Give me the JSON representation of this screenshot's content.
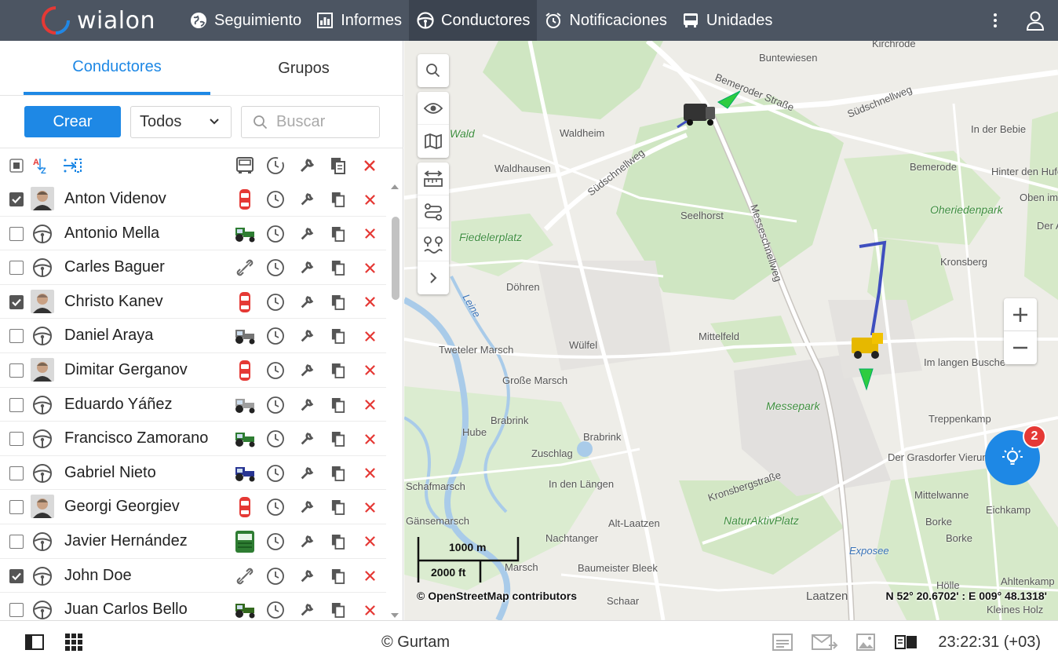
{
  "app": {
    "logo_text": "wialon"
  },
  "nav": [
    {
      "label": "Seguimiento",
      "icon": "globe-icon"
    },
    {
      "label": "Informes",
      "icon": "report-icon"
    },
    {
      "label": "Conductores",
      "icon": "steering-wheel-icon",
      "active": true
    },
    {
      "label": "Notificaciones",
      "icon": "alarm-clock-icon"
    },
    {
      "label": "Unidades",
      "icon": "bus-icon"
    }
  ],
  "panel": {
    "tabs": [
      "Conductores",
      "Grupos"
    ],
    "create_label": "Crear",
    "filter_value": "Todos",
    "search_placeholder": "Buscar"
  },
  "drivers": [
    {
      "name": "Anton Videnov",
      "checked": true,
      "avatar": "photo",
      "unit": "car",
      "unit_color": "#e53935"
    },
    {
      "name": "Antonio Mella",
      "checked": false,
      "avatar": "wheel",
      "unit": "tractor",
      "unit_color": "#2e7d32"
    },
    {
      "name": "Carles Baguer",
      "checked": false,
      "avatar": "wheel",
      "unit": "unlinked",
      "unit_color": "#666666"
    },
    {
      "name": "Christo Kanev",
      "checked": true,
      "avatar": "photo",
      "unit": "car",
      "unit_color": "#e53935"
    },
    {
      "name": "Daniel Araya",
      "checked": false,
      "avatar": "wheel",
      "unit": "tractor",
      "unit_color": "#757575"
    },
    {
      "name": "Dimitar Gerganov",
      "checked": false,
      "avatar": "photo",
      "unit": "car",
      "unit_color": "#e53935"
    },
    {
      "name": "Eduardo Yáñez",
      "checked": false,
      "avatar": "wheel",
      "unit": "tractor",
      "unit_color": "#9e9e9e"
    },
    {
      "name": "Francisco Zamorano",
      "checked": false,
      "avatar": "wheel",
      "unit": "tractor",
      "unit_color": "#2e7d32"
    },
    {
      "name": "Gabriel Nieto",
      "checked": false,
      "avatar": "wheel",
      "unit": "tractor",
      "unit_color": "#283593"
    },
    {
      "name": "Georgi Georgiev",
      "checked": false,
      "avatar": "photo",
      "unit": "car",
      "unit_color": "#e53935"
    },
    {
      "name": "Javier Hernández",
      "checked": false,
      "avatar": "wheel",
      "unit": "truck",
      "unit_color": "#2e7d32"
    },
    {
      "name": "John Doe",
      "checked": true,
      "avatar": "wheel",
      "unit": "unlinked",
      "unit_color": "#666666"
    },
    {
      "name": "Juan Carlos Bello",
      "checked": false,
      "avatar": "wheel",
      "unit": "tractor",
      "unit_color": "#33691e"
    }
  ],
  "map": {
    "places": [
      {
        "label": "Buntewiesen",
        "style": ""
      },
      {
        "label": "Bemeroder Straße",
        "style": ""
      },
      {
        "label": "Südschnellweg",
        "style": ""
      },
      {
        "label": "Waldheim",
        "style": ""
      },
      {
        "label": "Wald",
        "style": "green"
      },
      {
        "label": "In der Bebie",
        "style": ""
      },
      {
        "label": "Waldhausen",
        "style": ""
      },
      {
        "label": "Südschnellweg",
        "style": ""
      },
      {
        "label": "Bemerode",
        "style": ""
      },
      {
        "label": "Hinter den Hufen",
        "style": ""
      },
      {
        "label": "Oben im M",
        "style": ""
      },
      {
        "label": "Seelhorst",
        "style": ""
      },
      {
        "label": "Oheriedenpark",
        "style": "green"
      },
      {
        "label": "Messeschnellweg",
        "style": ""
      },
      {
        "label": "Der A",
        "style": ""
      },
      {
        "label": "Fiedelerplatz",
        "style": "green"
      },
      {
        "label": "Kronsberg",
        "style": ""
      },
      {
        "label": "Döhren",
        "style": ""
      },
      {
        "label": "Leine",
        "style": "blue"
      },
      {
        "label": "Mittelfeld",
        "style": ""
      },
      {
        "label": "Tweteler Marsch",
        "style": ""
      },
      {
        "label": "Wülfel",
        "style": ""
      },
      {
        "label": "Im langen Busche",
        "style": ""
      },
      {
        "label": "Große Marsch",
        "style": ""
      },
      {
        "label": "Messepark",
        "style": "green"
      },
      {
        "label": "Brabrink",
        "style": ""
      },
      {
        "label": "Brabrink",
        "style": ""
      },
      {
        "label": "Treppenkamp",
        "style": ""
      },
      {
        "label": "Hube",
        "style": ""
      },
      {
        "label": "Zuschlag",
        "style": ""
      },
      {
        "label": "Der Grasdorfer Vierun",
        "style": ""
      },
      {
        "label": "Schafmarsch",
        "style": ""
      },
      {
        "label": "In den Längen",
        "style": ""
      },
      {
        "label": "Kronsbergstraße",
        "style": ""
      },
      {
        "label": "Mittelwanne",
        "style": ""
      },
      {
        "label": "Eichkamp",
        "style": ""
      },
      {
        "label": "Gänsemarsch",
        "style": ""
      },
      {
        "label": "Alt-Laatzen",
        "style": ""
      },
      {
        "label": "NaturAktivPlatz",
        "style": "green"
      },
      {
        "label": "Borke",
        "style": ""
      },
      {
        "label": "Nachtanger",
        "style": ""
      },
      {
        "label": "Borke",
        "style": ""
      },
      {
        "label": "Baumeister Bleek",
        "style": ""
      },
      {
        "label": "Exposee",
        "style": "blue"
      },
      {
        "label": "Marsch",
        "style": ""
      },
      {
        "label": "Ahltenkamp",
        "style": ""
      },
      {
        "label": "Hölle",
        "style": ""
      },
      {
        "label": "Schaar",
        "style": ""
      },
      {
        "label": "Laatzen",
        "style": ""
      },
      {
        "label": "Kleines Holz",
        "style": ""
      },
      {
        "label": "Kirchrode",
        "style": ""
      }
    ],
    "scale_m": "1000 m",
    "scale_ft": "2000 ft",
    "attribution": "© OpenStreetMap contributors",
    "coordinates": "N 52° 20.6702' : E 009° 48.1318'",
    "notification_count": "2"
  },
  "status": {
    "copyright": "© Gurtam",
    "time": "23:22:31 (+03)"
  },
  "colors": {
    "accent": "#1e88e5",
    "topbar": "#4c5562",
    "delete": "#e53935"
  }
}
